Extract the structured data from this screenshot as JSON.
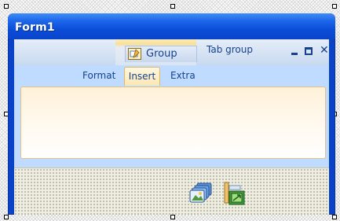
{
  "window": {
    "title": "Form1"
  },
  "ribbon": {
    "contextual_group_label": "Group",
    "tab_group_label": "Tab group",
    "tabs": [
      {
        "label": "Format",
        "selected": false
      },
      {
        "label": "Insert",
        "selected": true
      },
      {
        "label": "Extra",
        "selected": false
      }
    ]
  },
  "component_tray": {
    "icons": [
      "image-list-icon",
      "layout-component-icon"
    ]
  },
  "colors": {
    "titlebar": "#0b4cd8",
    "ribbon_background": "#bfdbff",
    "selected_tab_border": "#e6b85c",
    "label_text": "#15428b"
  }
}
